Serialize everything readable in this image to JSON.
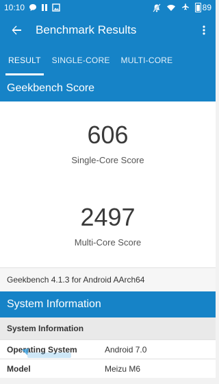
{
  "status_bar": {
    "time": "10:10",
    "battery": "89"
  },
  "app_bar": {
    "title": "Benchmark Results"
  },
  "tabs": [
    {
      "label": "RESULT",
      "active": true
    },
    {
      "label": "SINGLE-CORE",
      "active": false
    },
    {
      "label": "MULTI-CORE",
      "active": false
    }
  ],
  "geekbench": {
    "header": "Geekbench Score",
    "single_value": "606",
    "single_label": "Single-Core Score",
    "multi_value": "2497",
    "multi_label": "Multi-Core Score",
    "version": "Geekbench 4.1.3 for Android AArch64"
  },
  "system": {
    "header": "System Information",
    "subheader": "System Information",
    "rows": [
      {
        "key": "Operating System",
        "value": "Android 7.0"
      },
      {
        "key": "Model",
        "value": "Meizu M6"
      }
    ]
  },
  "colors": {
    "primary": "#1683c7",
    "text": "#3a3a3a"
  }
}
